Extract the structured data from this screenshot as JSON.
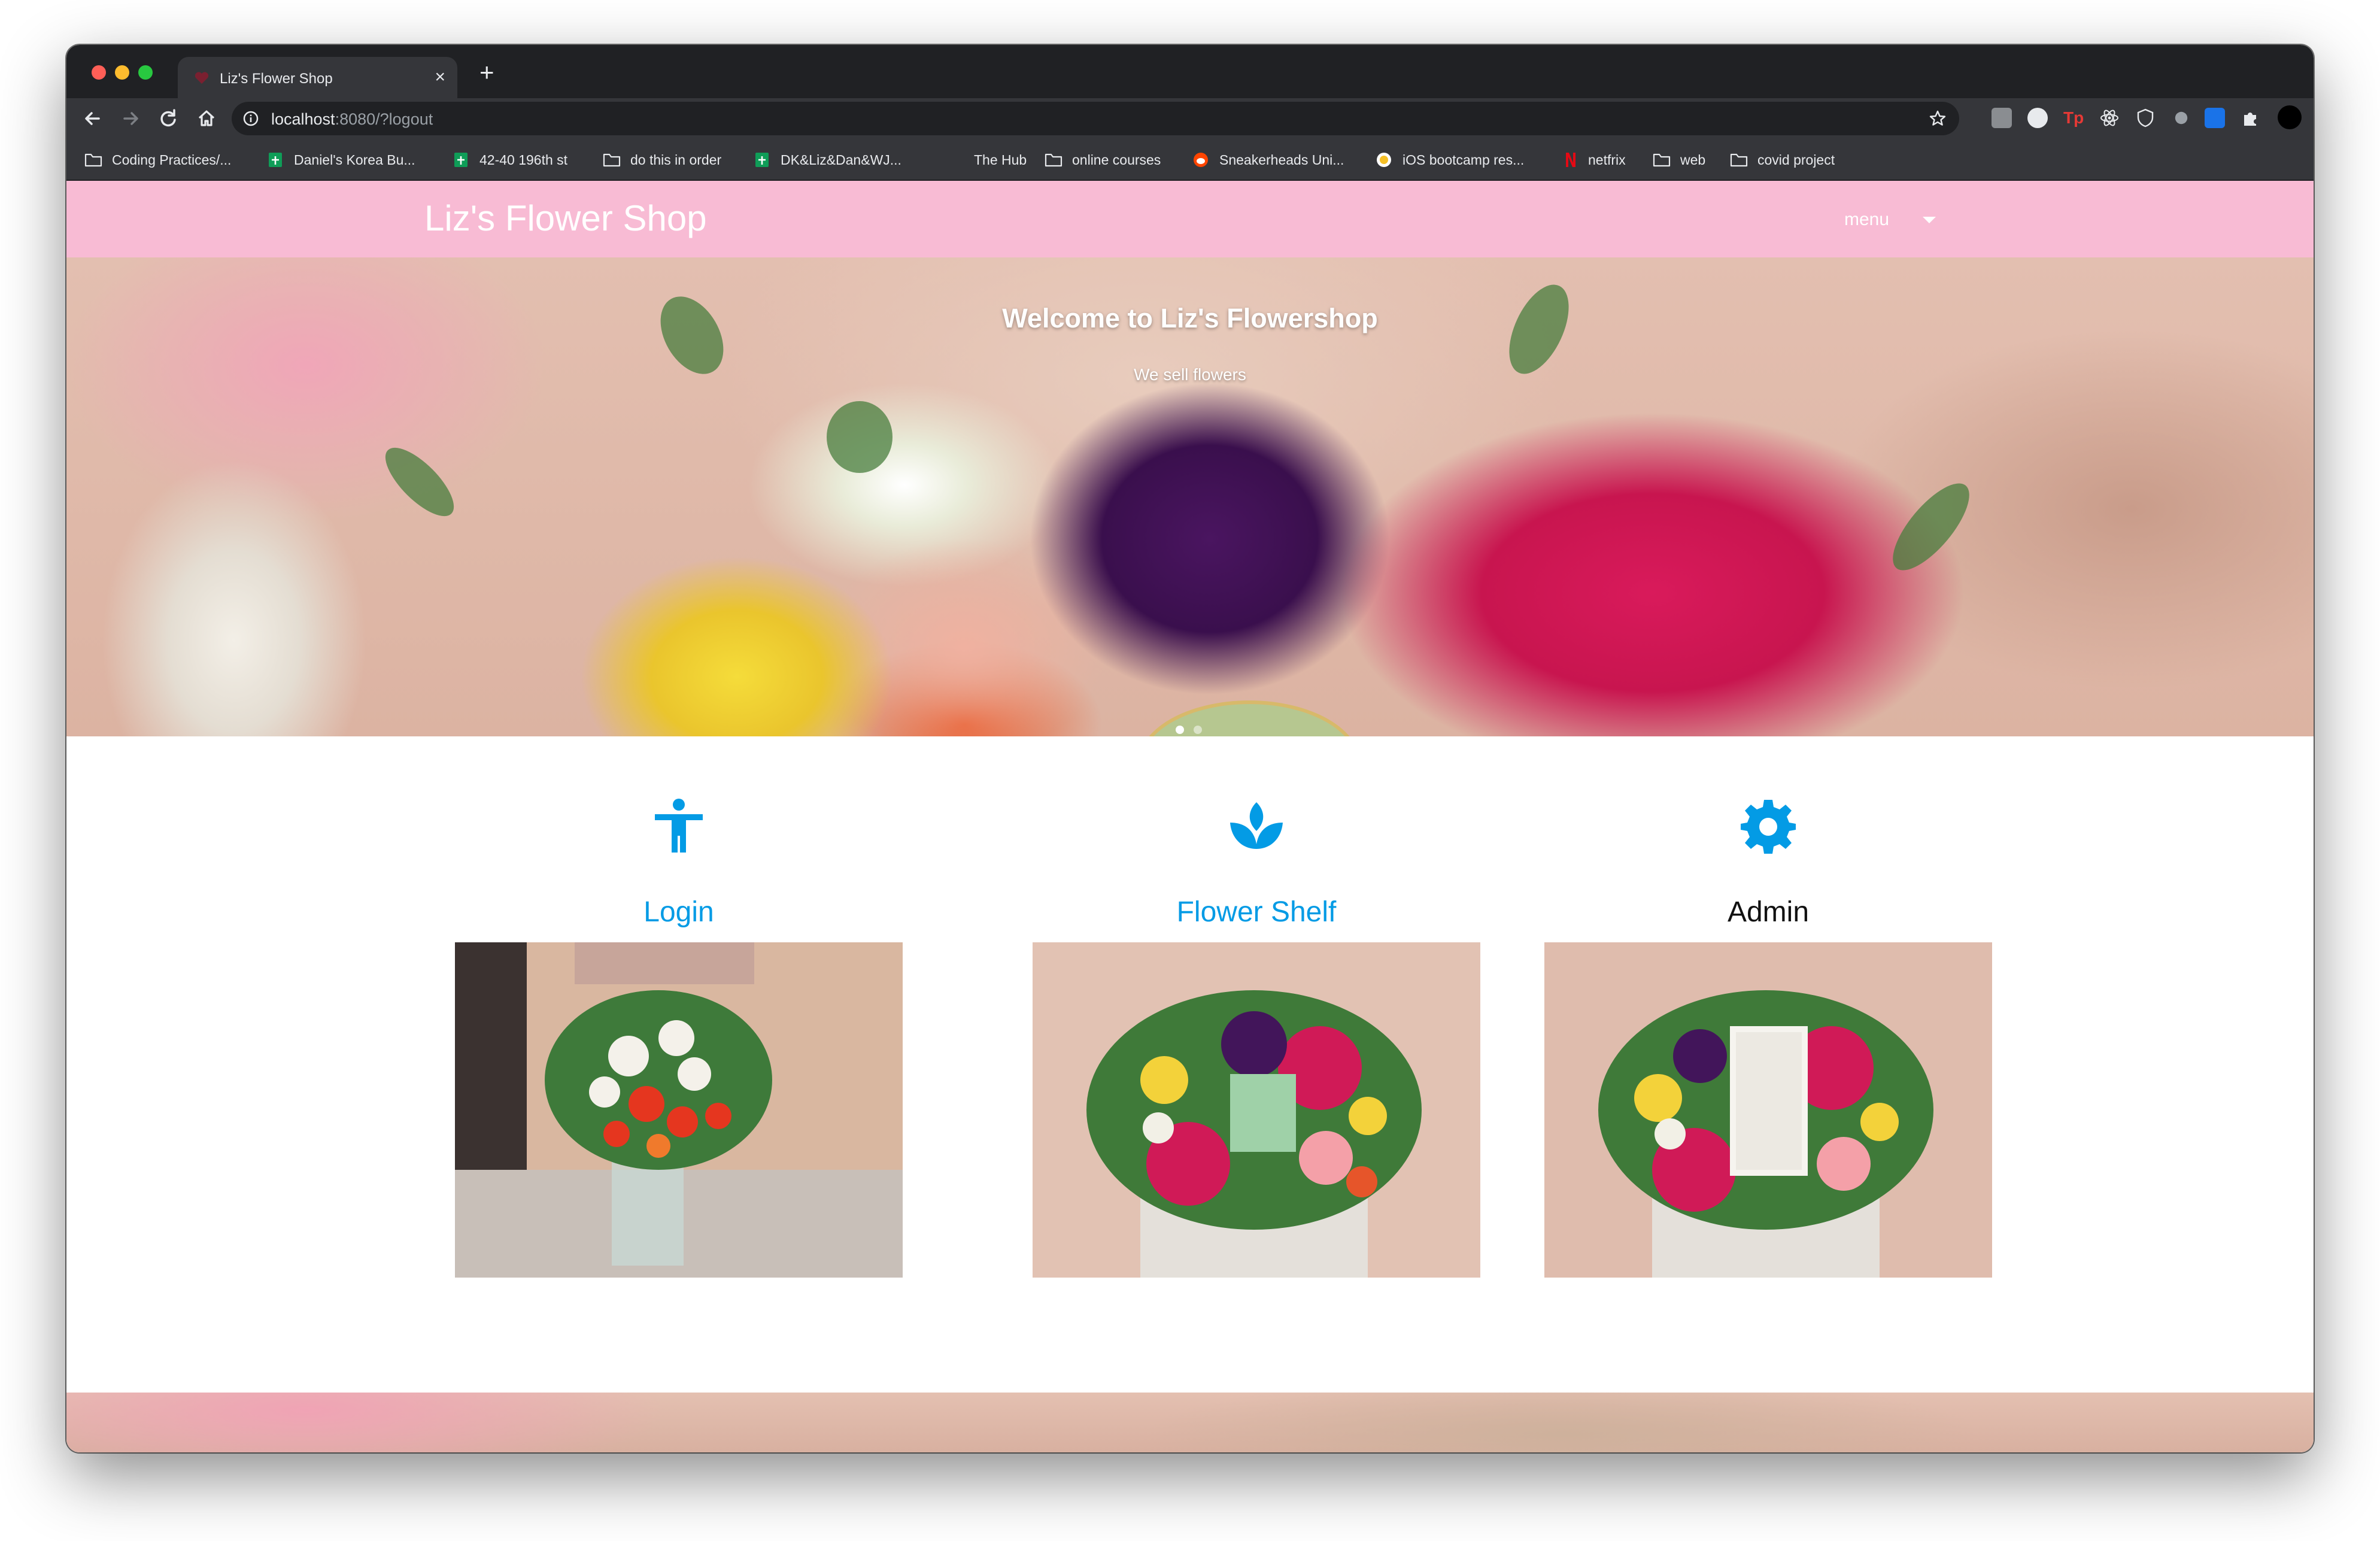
{
  "browser": {
    "tab_title": "Liz's Flower Shop",
    "tab_close": "×",
    "new_tab": "+",
    "url_host": "localhost",
    "url_rest": ":8080/?logout",
    "bookmarks": [
      {
        "label": "Coding Practices/...",
        "icon": "folder-icon"
      },
      {
        "label": "Daniel's Korea Bu...",
        "icon": "sheets-icon"
      },
      {
        "label": "42-40 196th st",
        "icon": "sheets-icon"
      },
      {
        "label": "do this in order",
        "icon": "folder-icon"
      },
      {
        "label": "DK&Liz&Dan&WJ...",
        "icon": "sheets-icon"
      },
      {
        "label": "The Hub",
        "icon": "blank-icon"
      },
      {
        "label": "online courses",
        "icon": "folder-icon"
      },
      {
        "label": "Sneakerheads Uni...",
        "icon": "reddit-icon"
      },
      {
        "label": "iOS bootcamp res...",
        "icon": "yellow-circle-icon"
      },
      {
        "label": "netfrix",
        "icon": "netflix-icon"
      },
      {
        "label": "web",
        "icon": "folder-icon"
      },
      {
        "label": "covid project",
        "icon": "folder-icon"
      }
    ]
  },
  "site": {
    "brand": "Liz's Flower Shop",
    "menu_label": "menu",
    "hero": {
      "title": "Welcome to Liz's Flowershop",
      "subtitle": "We sell flowers",
      "slides": 2,
      "active_slide": 1
    },
    "cards": [
      {
        "title": "Login",
        "icon": "accessibility-person-icon",
        "link_color": "#039be5",
        "image": "vase-bouquet-photo"
      },
      {
        "title": "Flower Shelf",
        "icon": "spa-lotus-icon",
        "link_color": "#039be5",
        "image": "flower-box-clinique-photo"
      },
      {
        "title": "Admin",
        "icon": "gear-icon",
        "link_color": "#111111",
        "image": "flower-box-chanel-photo"
      }
    ]
  },
  "colors": {
    "navbar": "#f8bbd4",
    "accent": "#039be5"
  }
}
